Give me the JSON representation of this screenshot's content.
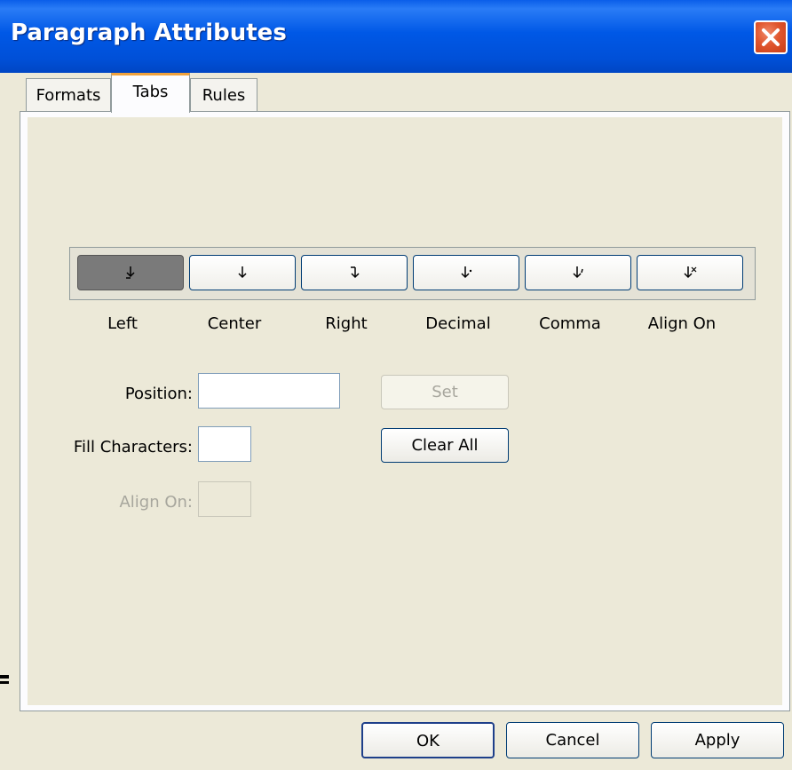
{
  "window": {
    "title": "Paragraph Attributes"
  },
  "tabs": [
    {
      "label": "Formats"
    },
    {
      "label": "Tabs"
    },
    {
      "label": "Rules"
    }
  ],
  "alignment": {
    "selected": "Left",
    "options": [
      {
        "label": "Left",
        "icon": "tab-left-icon"
      },
      {
        "label": "Center",
        "icon": "tab-center-icon"
      },
      {
        "label": "Right",
        "icon": "tab-right-icon"
      },
      {
        "label": "Decimal",
        "icon": "tab-decimal-icon"
      },
      {
        "label": "Comma",
        "icon": "tab-comma-icon"
      },
      {
        "label": "Align On",
        "icon": "tab-align-on-icon"
      }
    ]
  },
  "fields": {
    "position_label": "Position:",
    "position_value": "",
    "fill_label": "Fill Characters:",
    "fill_value": "",
    "align_on_label": "Align On:",
    "align_on_value": ""
  },
  "buttons": {
    "set": "Set",
    "clear_all": "Clear All",
    "ok": "OK",
    "cancel": "Cancel",
    "apply": "Apply"
  },
  "colors": {
    "titlebar": "#0058e6",
    "dialog_bg": "#ece9d8",
    "active_tab_accent": "#f0a23c",
    "close_button": "#e0562e"
  }
}
